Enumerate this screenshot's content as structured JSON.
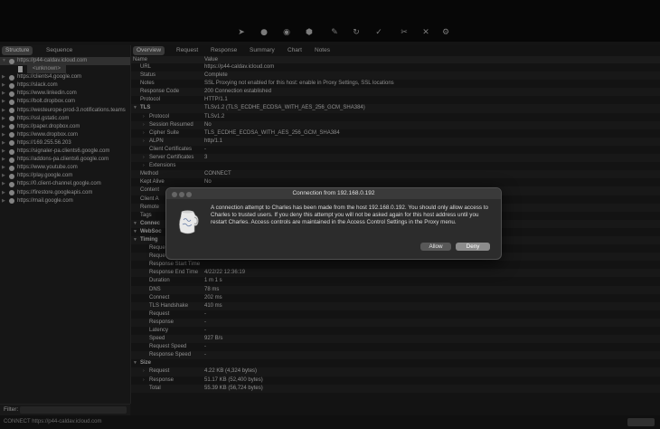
{
  "toolbar": {
    "icons": [
      "pointer-icon",
      "record-icon",
      "throttle-icon",
      "breakpoint-icon",
      "pen-icon",
      "refresh-icon",
      "check-icon",
      "tools-icon",
      "settings-icon"
    ]
  },
  "left": {
    "tabs": [
      "Structure",
      "Sequence"
    ],
    "tree": [
      {
        "label": "https://p44-caldav.icloud.com",
        "selected": true
      },
      {
        "label": "<unknown>",
        "child": true
      },
      {
        "label": "https://clients4.google.com"
      },
      {
        "label": "https://slack.com"
      },
      {
        "label": "https://www.linkedin.com"
      },
      {
        "label": "https://bolt.dropbox.com"
      },
      {
        "label": "https://westeurope-prod-3.notifications.teams"
      },
      {
        "label": "https://ssl.gstatic.com"
      },
      {
        "label": "https://paper.dropbox.com"
      },
      {
        "label": "https://www.dropbox.com"
      },
      {
        "label": "https://169.255.56.203"
      },
      {
        "label": "https://signaler-pa.clients6.google.com"
      },
      {
        "label": "https://addons-pa.clients6.google.com"
      },
      {
        "label": "https://www.youtube.com"
      },
      {
        "label": "https://play.google.com"
      },
      {
        "label": "https://0.client-channel.google.com"
      },
      {
        "label": "https://firestore.googleapis.com"
      },
      {
        "label": "https://mail.google.com"
      }
    ],
    "filter_label": "Filter:"
  },
  "right": {
    "tabs": [
      "Overview",
      "Request",
      "Response",
      "Summary",
      "Chart",
      "Notes"
    ],
    "header": {
      "name": "Name",
      "value": "Value"
    },
    "rows": [
      {
        "n": "URL",
        "v": "https://p44-caldav.icloud.com"
      },
      {
        "n": "Status",
        "v": "Complete"
      },
      {
        "n": "Notes",
        "v": "SSL Proxying not enabled for this host: enable in Proxy Settings, SSL locations"
      },
      {
        "n": "Response Code",
        "v": "200 Connection established"
      },
      {
        "n": "Protocol",
        "v": "HTTP/1.1"
      },
      {
        "n": "TLS",
        "v": "TLSv1.2 (TLS_ECDHE_ECDSA_WITH_AES_256_GCM_SHA384)",
        "group": true
      },
      {
        "n": "Protocol",
        "v": "TLSv1.2",
        "sub": true,
        "arrow": true
      },
      {
        "n": "Session Resumed",
        "v": "No",
        "sub": true,
        "arrow": true
      },
      {
        "n": "Cipher Suite",
        "v": "TLS_ECDHE_ECDSA_WITH_AES_256_GCM_SHA384",
        "sub": true,
        "arrow": true
      },
      {
        "n": "ALPN",
        "v": "http/1.1",
        "sub": true,
        "arrow": true
      },
      {
        "n": "Client Certificates",
        "v": "-",
        "sub": true
      },
      {
        "n": "Server Certificates",
        "v": "3",
        "sub": true,
        "arrow": true
      },
      {
        "n": "Extensions",
        "v": "",
        "sub": true,
        "arrow": true
      },
      {
        "n": "Method",
        "v": "CONNECT"
      },
      {
        "n": "Kept Alive",
        "v": "No"
      },
      {
        "n": "Content",
        "v": ""
      },
      {
        "n": "Client A",
        "v": ""
      },
      {
        "n": "Remote",
        "v": ""
      },
      {
        "n": "Tags",
        "v": ""
      },
      {
        "n": "Connec",
        "v": "",
        "group": true
      },
      {
        "n": "WebSoc",
        "v": "",
        "group": true
      },
      {
        "n": "Timing",
        "v": "",
        "group": true
      },
      {
        "n": "Reque",
        "v": "",
        "sub": true
      },
      {
        "n": "Reque",
        "v": "",
        "sub": true
      },
      {
        "n": "Response Start Time",
        "v": "",
        "sub": true
      },
      {
        "n": "Response End Time",
        "v": "4/22/22 12:36:19",
        "sub": true
      },
      {
        "n": "Duration",
        "v": "1 m 1 s",
        "sub": true
      },
      {
        "n": "DNS",
        "v": "78 ms",
        "sub": true
      },
      {
        "n": "Connect",
        "v": "202 ms",
        "sub": true
      },
      {
        "n": "TLS Handshake",
        "v": "410 ms",
        "sub": true
      },
      {
        "n": "Request",
        "v": "-",
        "sub": true
      },
      {
        "n": "Response",
        "v": "-",
        "sub": true
      },
      {
        "n": "Latency",
        "v": "-",
        "sub": true
      },
      {
        "n": "Speed",
        "v": "927 B/s",
        "sub": true
      },
      {
        "n": "Request Speed",
        "v": "-",
        "sub": true
      },
      {
        "n": "Response Speed",
        "v": "-",
        "sub": true
      },
      {
        "n": "Size",
        "v": "",
        "group": true
      },
      {
        "n": "Request",
        "v": "4.22 KB (4,324 bytes)",
        "sub": true,
        "arrow": true
      },
      {
        "n": "Response",
        "v": "51.17 KB (52,400 bytes)",
        "sub": true,
        "arrow": true
      },
      {
        "n": "Total",
        "v": "55.39 KB (56,724 bytes)",
        "sub": true
      }
    ]
  },
  "dialog": {
    "title": "Connection from 192.168.0.192",
    "message": "A connection attempt to Charles has been made from the host 192.168.0.192. You should only allow access to Charles to trusted users. If you deny this attempt you will not be asked again for this host address until you restart Charles. Access controls are maintained in the Access Control Settings in the Proxy menu.",
    "allow": "Allow",
    "deny": "Deny"
  },
  "status": {
    "text": "CONNECT https://p44-caldav.icloud.com"
  }
}
